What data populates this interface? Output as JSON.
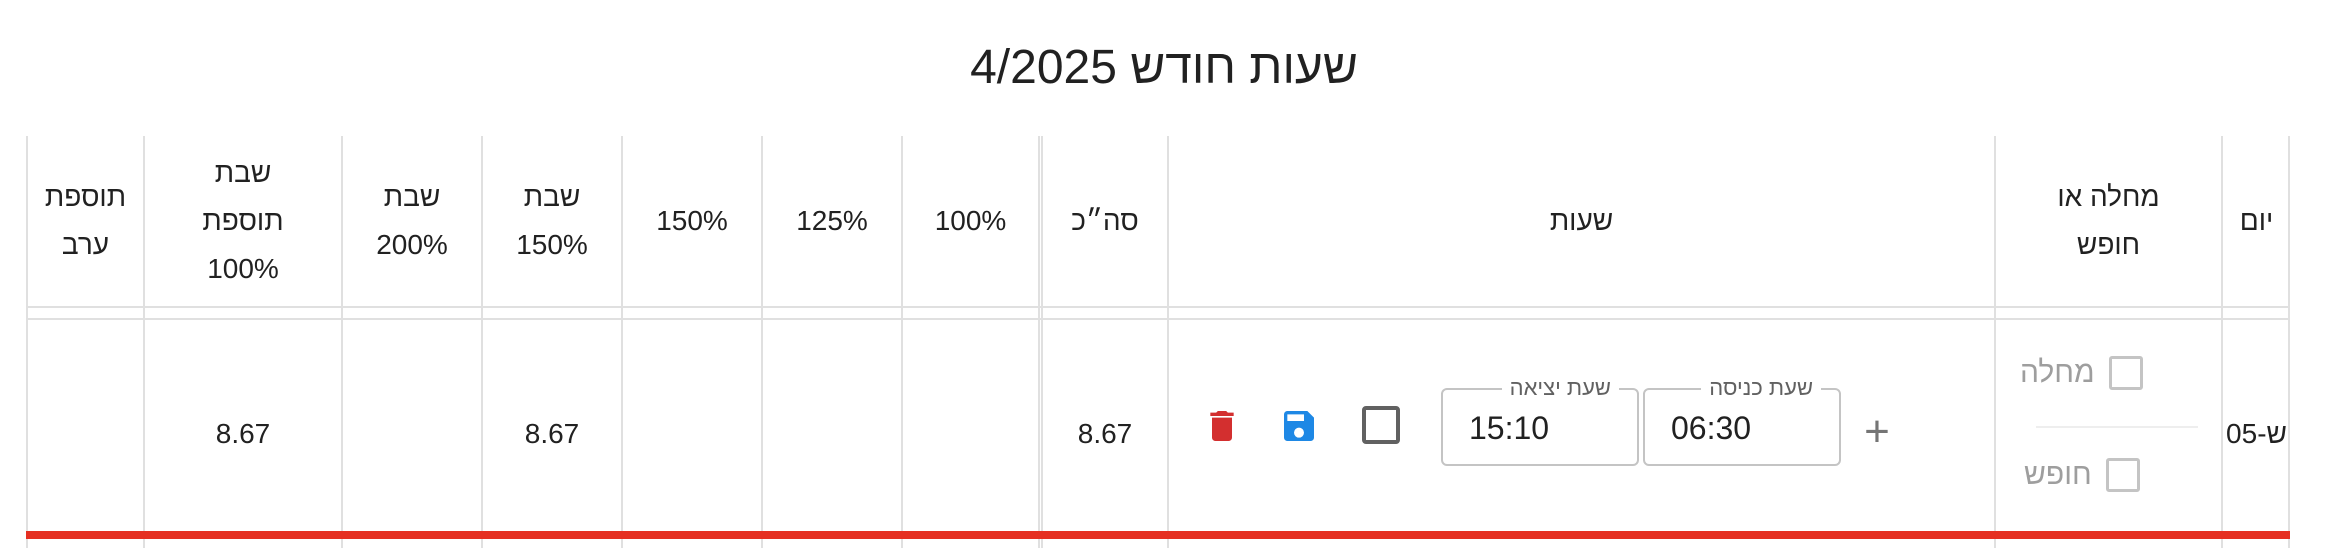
{
  "title": "שעות חודש 4/2025",
  "columns": {
    "day": "יום",
    "leave": "מחלה או חופש",
    "hours": "שעות",
    "total": "סה״כ",
    "p100": "100%",
    "p125": "125%",
    "p150": "150%",
    "shabbat150": "שבת 150%",
    "shabbat200": "שבת 200%",
    "shabbat_extra100": "שבת תוספת 100%",
    "evening_extra": "תוספת ערב"
  },
  "row": {
    "day": "ש-05",
    "sick_label": "מחלה",
    "vacation_label": "חופש",
    "entry_label": "שעת כניסה",
    "entry_value": "06:30",
    "exit_label": "שעת יציאה",
    "exit_value": "15:10",
    "total": "8.67",
    "p100": "",
    "p125": "",
    "p150": "",
    "shabbat150": "8.67",
    "shabbat200": "",
    "shabbat_extra100": "8.67",
    "evening_extra": ""
  },
  "icons": {
    "add": "plus-icon",
    "save": "floppy-disk-icon",
    "delete": "trash-icon"
  },
  "colors": {
    "delete": "#d32f2f",
    "save": "#1e88e5",
    "highlight_line": "#e53022"
  }
}
